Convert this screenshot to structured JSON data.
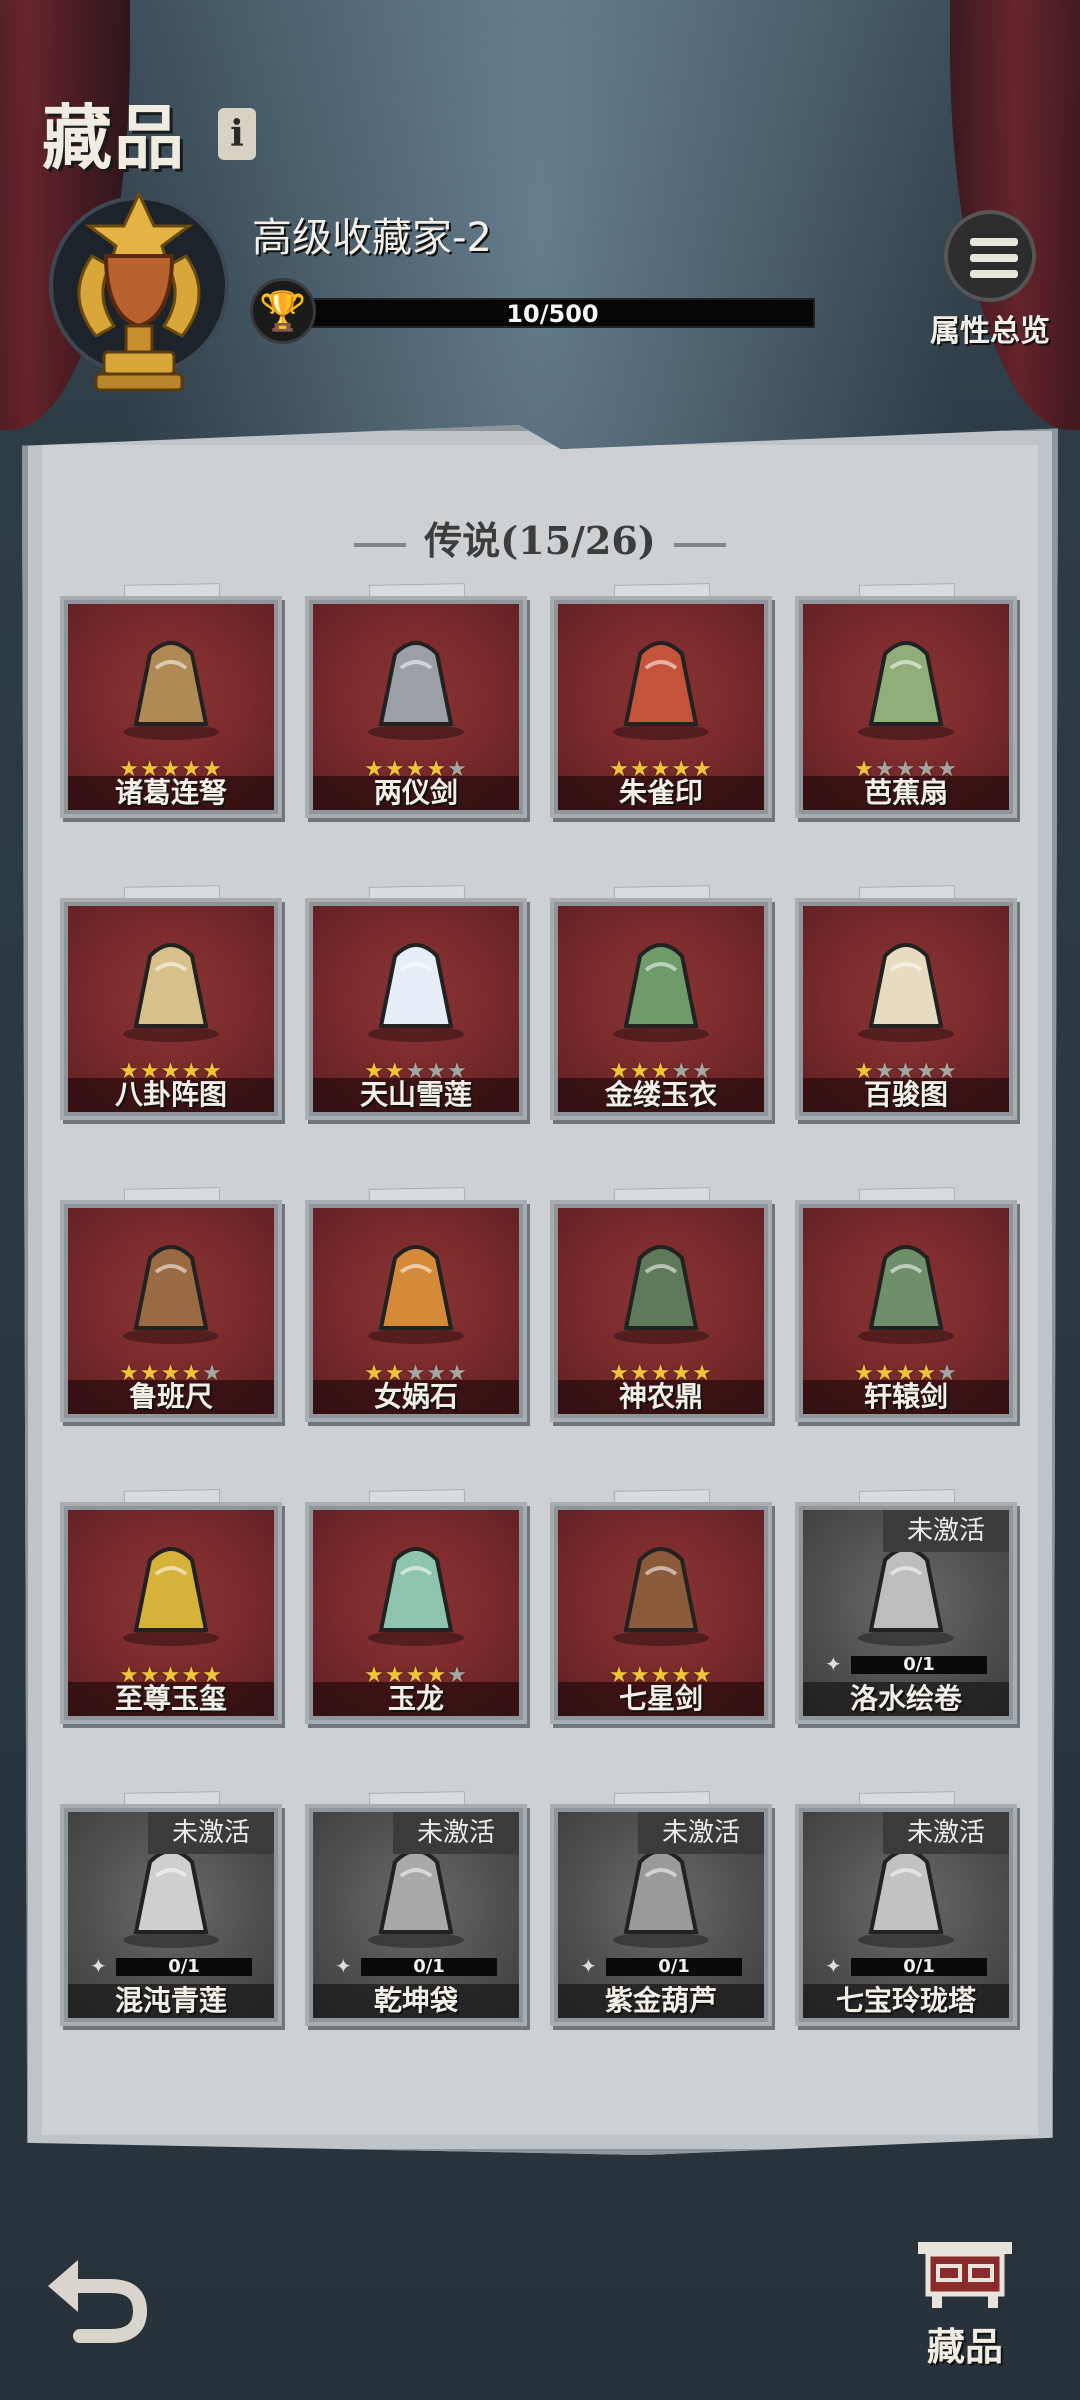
{
  "header": {
    "title": "藏品",
    "info_icon_label": "i",
    "rank_name": "高级收藏家-2",
    "progress_text": "10/500",
    "progress_fraction": 0.02,
    "attr_button_label": "属性总览"
  },
  "section": {
    "title": "传说(15/26)"
  },
  "items": [
    {
      "name": "诸葛连弩",
      "stars": 5,
      "active": true
    },
    {
      "name": "两仪剑",
      "stars": 4,
      "active": true
    },
    {
      "name": "朱雀印",
      "stars": 5,
      "active": true
    },
    {
      "name": "芭蕉扇",
      "stars": 1,
      "active": true
    },
    {
      "name": "八卦阵图",
      "stars": 5,
      "active": true
    },
    {
      "name": "天山雪莲",
      "stars": 2,
      "active": true
    },
    {
      "name": "金缕玉衣",
      "stars": 3,
      "active": true
    },
    {
      "name": "百骏图",
      "stars": 1,
      "active": true
    },
    {
      "name": "鲁班尺",
      "stars": 4,
      "active": true
    },
    {
      "name": "女娲石",
      "stars": 2,
      "active": true
    },
    {
      "name": "神农鼎",
      "stars": 5,
      "active": true
    },
    {
      "name": "轩辕剑",
      "stars": 4,
      "active": true
    },
    {
      "name": "至尊玉玺",
      "stars": 5,
      "active": true
    },
    {
      "name": "玉龙",
      "stars": 4,
      "active": true
    },
    {
      "name": "七星剑",
      "stars": 5,
      "active": true
    },
    {
      "name": "洛水绘卷",
      "active": false,
      "progress": "0/1",
      "status": "未激活"
    },
    {
      "name": "混沌青莲",
      "active": false,
      "progress": "0/1",
      "status": "未激活"
    },
    {
      "name": "乾坤袋",
      "active": false,
      "progress": "0/1",
      "status": "未激活"
    },
    {
      "name": "紫金葫芦",
      "active": false,
      "progress": "0/1",
      "status": "未激活"
    },
    {
      "name": "七宝玲珑塔",
      "active": false,
      "progress": "0/1",
      "status": "未激活"
    }
  ],
  "bottom_nav": {
    "tab_label": "藏品"
  },
  "colors": {
    "star_on": "#f1c33a",
    "star_off": "#a5a5a5",
    "card_active": "#7c2b2d",
    "card_inactive": "#505050",
    "progress_fill": "#c9a236"
  }
}
